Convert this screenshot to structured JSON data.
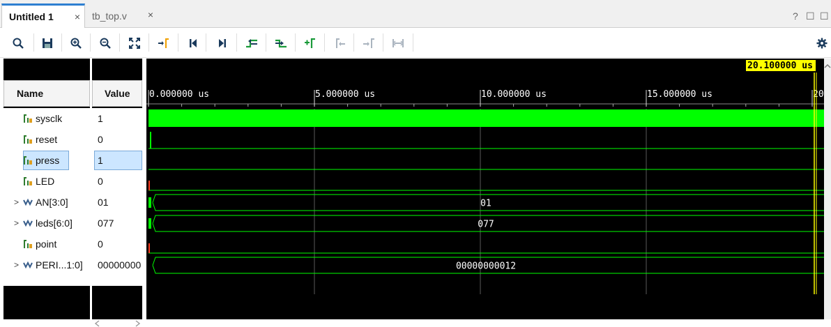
{
  "tabs": [
    {
      "label": "Untitled 1",
      "close": "×"
    },
    {
      "label": "tb_top.v",
      "close": "×"
    }
  ],
  "window_controls": [
    "?",
    "☐",
    "☐"
  ],
  "toolbar": {
    "items": [
      "search-icon",
      "save-icon",
      "zoom-in-icon",
      "zoom-out-icon",
      "zoom-fit-icon",
      "go-to-cursor-icon",
      "go-to-start-icon",
      "go-to-end-icon",
      "previous-transition-icon",
      "next-transition-icon",
      "add-marker-icon",
      "previous-marker-icon",
      "next-marker-icon",
      "swap-cursors-icon",
      "settings-icon"
    ]
  },
  "headers": {
    "name": "Name",
    "value": "Value"
  },
  "signals": [
    {
      "name": "sysclk",
      "value": "1",
      "bus": false
    },
    {
      "name": "reset",
      "value": "0",
      "bus": false
    },
    {
      "name": "press",
      "value": "1",
      "bus": false,
      "selected": true
    },
    {
      "name": "LED",
      "value": "0",
      "bus": false
    },
    {
      "name": "AN[3:0]",
      "value": "01",
      "bus": true,
      "wave_label": "01"
    },
    {
      "name": "leds[6:0]",
      "value": "077",
      "bus": true,
      "wave_label": "077"
    },
    {
      "name": "point",
      "value": "0",
      "bus": false
    },
    {
      "name": "PERI...1:0]",
      "value": "00000000",
      "bus": true,
      "wave_label": "00000000012"
    }
  ],
  "timeline": {
    "ticks": [
      "0.000000 us",
      "5.000000 us",
      "10.000000 us",
      "15.000000 us",
      "20"
    ],
    "cursor_label": "20.100000 us"
  },
  "colors": {
    "wave_bg": "#000000",
    "wave": "#00ff00",
    "cursor": "#ffff00",
    "transition": "#ff3b1f",
    "selection": "#cce6ff"
  }
}
